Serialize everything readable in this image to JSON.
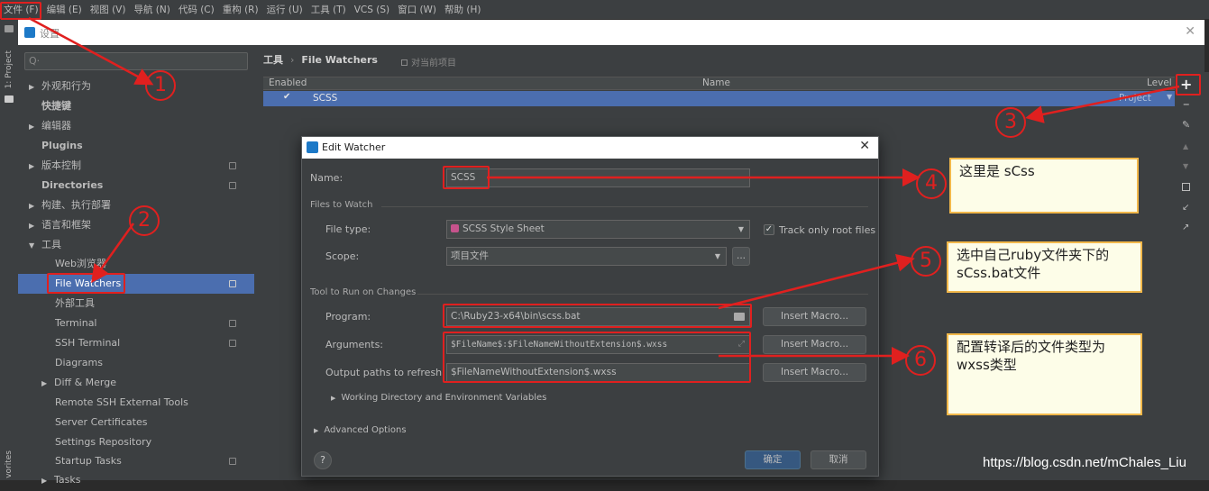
{
  "menubar": {
    "items": [
      "文件 (F)",
      "编辑 (E)",
      "视图 (V)",
      "导航 (N)",
      "代码 (C)",
      "重构 (R)",
      "运行 (U)",
      "工具 (T)",
      "VCS (S)",
      "窗口 (W)",
      "帮助 (H)"
    ]
  },
  "toolwindow": {
    "project_tab": "1: Project",
    "favorites_tab": "vorites"
  },
  "settings": {
    "title": "设置",
    "search_placeholder": "Q·",
    "tree": [
      {
        "label": "外观和行为",
        "arrow": "▶"
      },
      {
        "label": "快捷键",
        "arrow": ""
      },
      {
        "label": "编辑器",
        "arrow": "▶"
      },
      {
        "label": "Plugins",
        "arrow": ""
      },
      {
        "label": "版本控制",
        "arrow": "▶"
      },
      {
        "label": "Directories",
        "arrow": ""
      },
      {
        "label": "构建、执行部署",
        "arrow": "▶"
      },
      {
        "label": "语言和框架",
        "arrow": "▶"
      },
      {
        "label": "工具",
        "arrow": "▼"
      },
      {
        "label": "Web浏览器",
        "arrow": ""
      },
      {
        "label": "File Watchers",
        "arrow": ""
      },
      {
        "label": "外部工具",
        "arrow": ""
      },
      {
        "label": "Terminal",
        "arrow": ""
      },
      {
        "label": "SSH Terminal",
        "arrow": ""
      },
      {
        "label": "Diagrams",
        "arrow": ""
      },
      {
        "label": "Diff & Merge",
        "arrow": "▶"
      },
      {
        "label": "Remote SSH External Tools",
        "arrow": ""
      },
      {
        "label": "Server Certificates",
        "arrow": ""
      },
      {
        "label": "Settings Repository",
        "arrow": ""
      },
      {
        "label": "Startup Tasks",
        "arrow": ""
      },
      {
        "label": "Tasks",
        "arrow": "▶"
      }
    ],
    "breadcrumb": {
      "root": "工具",
      "sep": "›",
      "leaf": "File Watchers",
      "scope": "对当前项目"
    },
    "table": {
      "headers": {
        "enabled": "Enabled",
        "name": "Name",
        "level": "Level"
      },
      "rows": [
        {
          "enabled": "✔",
          "name": "SCSS",
          "level": "Project"
        }
      ]
    }
  },
  "dialog": {
    "title": "Edit Watcher",
    "name_label": "Name:",
    "name_value": "SCSS",
    "files_section": "Files to Watch",
    "file_type_label": "File type:",
    "file_type_value": "SCSS Style Sheet",
    "track_root_label": "Track only root files",
    "scope_label": "Scope:",
    "scope_value": "项目文件",
    "scope_more": "...",
    "tool_section": "Tool to Run on Changes",
    "program_label": "Program:",
    "program_value": "C:\\Ruby23-x64\\bin\\scss.bat",
    "arguments_label": "Arguments:",
    "arguments_value": "$FileName$:$FileNameWithoutExtension$.wxss",
    "output_label": "Output paths to refresh:",
    "output_value": "$FileNameWithoutExtension$.wxss",
    "insert_macro": "Insert Macro...",
    "workdir": "Working Directory and Environment Variables",
    "advanced": "Advanced Options",
    "help": "?",
    "ok": "确定",
    "cancel": "取消"
  },
  "annotations": {
    "c1": "1",
    "c2": "2",
    "c3": "3",
    "c4": "4",
    "c5": "5",
    "c6": "6",
    "note4": "这里是 sCss",
    "note5": "选中自己ruby文件夹下的sCss.bat文件",
    "note6": "配置转译后的文件类型为wxss类型"
  },
  "watermark": "https://blog.csdn.net/mChales_Liu",
  "colors": {
    "selection": "#4b6eaf",
    "annotation": "#e0201f",
    "note_border": "#f2b84a"
  }
}
